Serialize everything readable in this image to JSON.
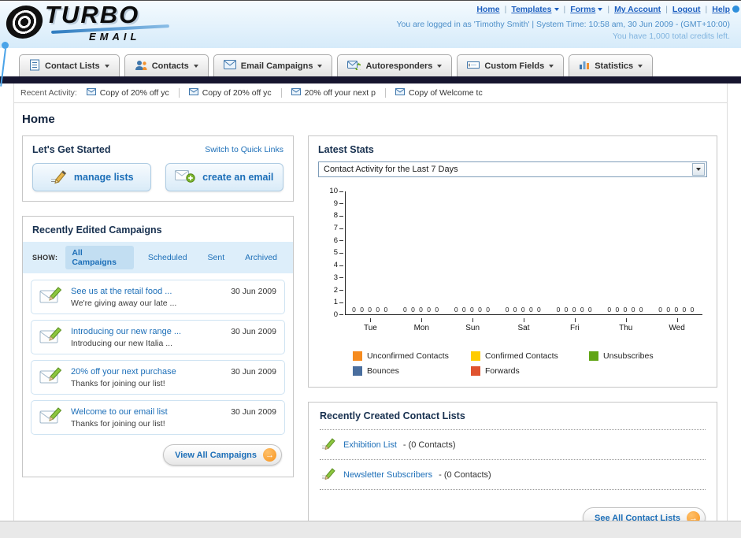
{
  "header": {
    "logo": {
      "title": "TURBO",
      "subtitle": "EMAIL"
    },
    "separator": "|",
    "top_links": [
      {
        "label": "Home"
      },
      {
        "label": "Templates"
      },
      {
        "label": "Forms"
      },
      {
        "label": "My Account"
      },
      {
        "label": "Logout"
      },
      {
        "label": "Help"
      }
    ],
    "login_info": "You are logged in as 'Timothy Smith' | System Time: 10:58 am, 30 Jun 2009 - (GMT+10:00)",
    "credits_info": "You have 1,000 total credits left."
  },
  "nav_tabs": [
    {
      "label": "Contact Lists"
    },
    {
      "label": "Contacts"
    },
    {
      "label": "Email Campaigns"
    },
    {
      "label": "Autoresponders"
    },
    {
      "label": "Custom Fields"
    },
    {
      "label": "Statistics"
    }
  ],
  "activity": {
    "label": "Recent Activity:",
    "items": [
      "Copy of 20% off yc",
      "Copy of 20% off yc",
      "20% off your next p",
      "Copy of Welcome tc"
    ]
  },
  "page": {
    "title": "Home"
  },
  "get_started": {
    "title": "Let's Get Started",
    "switch_link": "Switch to Quick Links",
    "manage_lists": "manage lists",
    "create_email": "create an email"
  },
  "campaigns": {
    "title": "Recently Edited Campaigns",
    "show_label": "SHOW:",
    "tabs": [
      "All Campaigns",
      "Scheduled",
      "Sent",
      "Archived"
    ],
    "selected_tab": "All Campaigns",
    "items": [
      {
        "title": "See us at the retail food ...",
        "subtitle": "We're giving away our late ...",
        "date": "30 Jun 2009"
      },
      {
        "title": "Introducing our new range ...",
        "subtitle": "Introducing our new Italia ...",
        "date": "30 Jun 2009"
      },
      {
        "title": "20% off your next purchase",
        "subtitle": "Thanks for joining our list!",
        "date": "30 Jun 2009"
      },
      {
        "title": "Welcome to our email list",
        "subtitle": "Thanks for joining our list!",
        "date": "30 Jun 2009"
      }
    ],
    "view_all_label": "View All Campaigns"
  },
  "stats": {
    "title": "Latest Stats",
    "dropdown_value": "Contact Activity for the Last 7 Days",
    "chart_data": {
      "type": "line",
      "title": "Contact Activity for the Last 7 Days",
      "categories": [
        "Tue",
        "Mon",
        "Sun",
        "Sat",
        "Fri",
        "Thu",
        "Wed"
      ],
      "series": [
        {
          "name": "Unconfirmed Contacts",
          "color": "#f68b1f",
          "values": [
            0,
            0,
            0,
            0,
            0,
            0,
            0
          ]
        },
        {
          "name": "Confirmed Contacts",
          "color": "#ffcc00",
          "values": [
            0,
            0,
            0,
            0,
            0,
            0,
            0
          ]
        },
        {
          "name": "Unsubscribes",
          "color": "#61a515",
          "values": [
            0,
            0,
            0,
            0,
            0,
            0,
            0
          ]
        },
        {
          "name": "Bounces",
          "color": "#4a6e9e",
          "values": [
            0,
            0,
            0,
            0,
            0,
            0,
            0
          ]
        },
        {
          "name": "Forwards",
          "color": "#e0532f",
          "values": [
            0,
            0,
            0,
            0,
            0,
            0,
            0
          ]
        }
      ],
      "ylim": [
        0,
        10
      ],
      "yticks": [
        "10",
        "9",
        "8",
        "7",
        "6",
        "5",
        "4",
        "3",
        "2",
        "1",
        "0"
      ],
      "point_label_row": "0 0 0 0 0",
      "grid": false,
      "legend_position": "bottom"
    }
  },
  "contact_lists": {
    "title": "Recently Created Contact Lists",
    "items": [
      {
        "name": "Exhibition List",
        "suffix": "- (0 Contacts)"
      },
      {
        "name": "Newsletter Subscribers",
        "suffix": "- (0 Contacts)"
      }
    ],
    "see_all_label": "See All Contact Lists"
  },
  "icons": {
    "forward_arrow": "→"
  }
}
